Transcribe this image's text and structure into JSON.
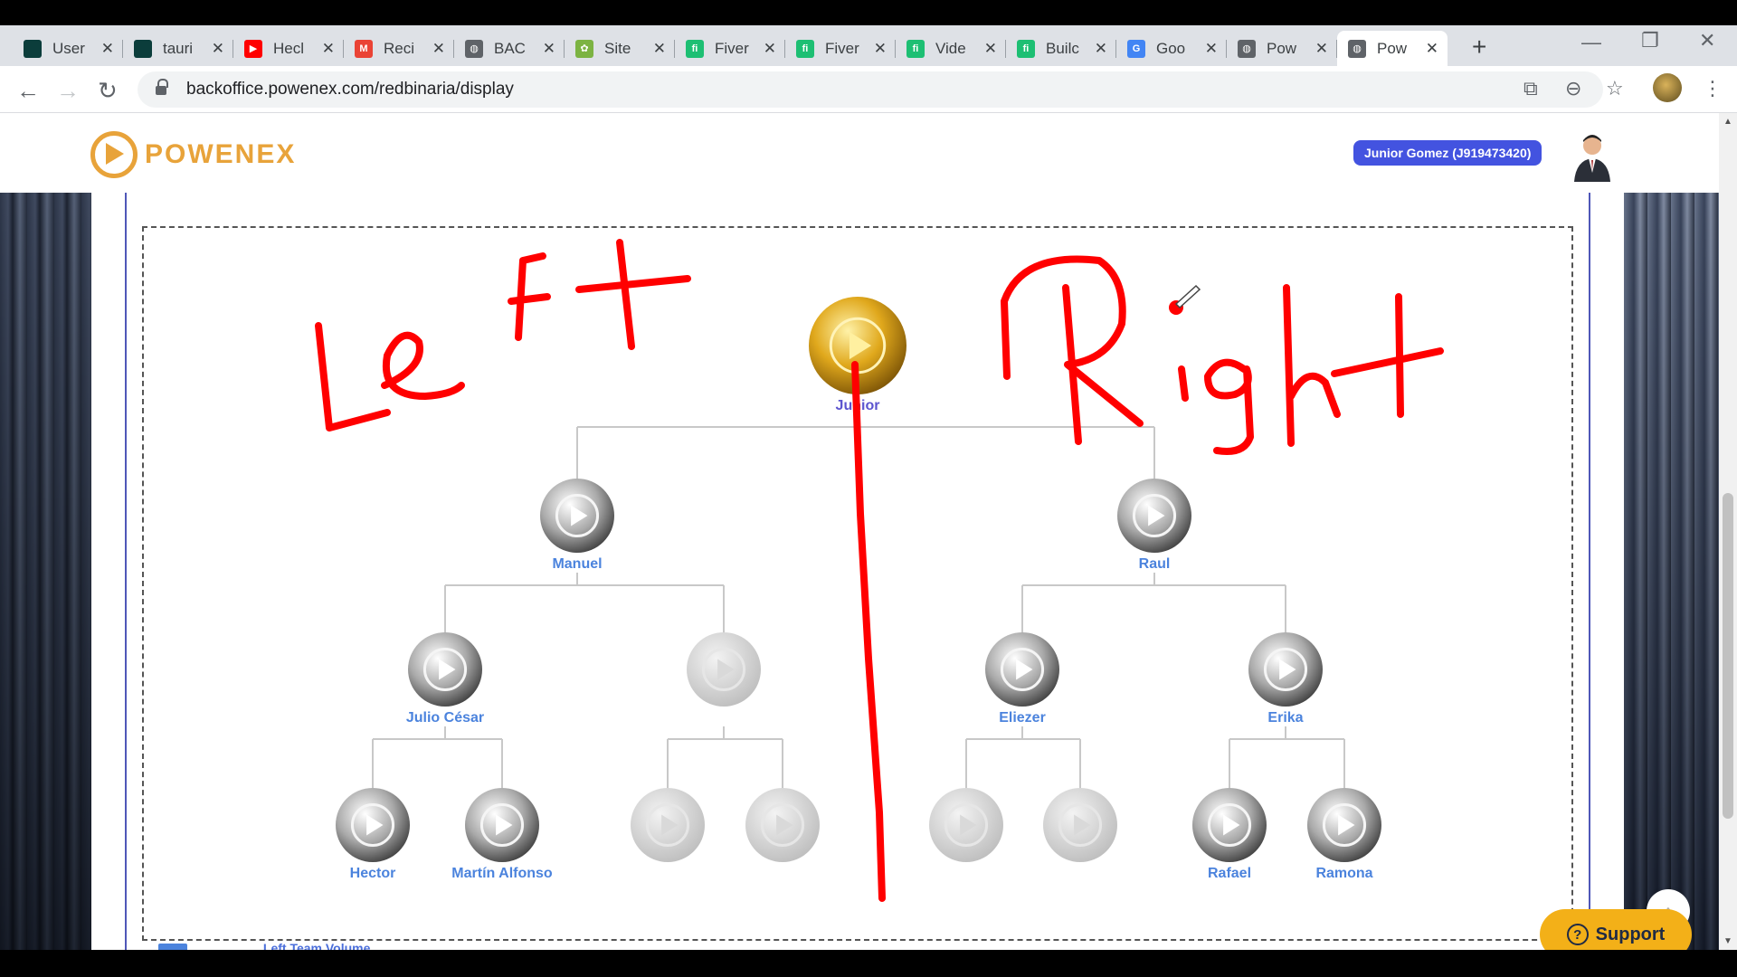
{
  "tabs": [
    {
      "title": "User",
      "favicon_color": "#0b3d3b",
      "favicon_glyph": ""
    },
    {
      "title": "tauri",
      "favicon_color": "#0b3d3b",
      "favicon_glyph": ""
    },
    {
      "title": "Hecl",
      "favicon_color": "#ff0000",
      "favicon_glyph": "▶"
    },
    {
      "title": "Reci",
      "favicon_color": "#ea4335",
      "favicon_glyph": "M"
    },
    {
      "title": "BAC",
      "favicon_color": "#5f6368",
      "favicon_glyph": "◍"
    },
    {
      "title": "Site",
      "favicon_color": "#7cb342",
      "favicon_glyph": "✿"
    },
    {
      "title": "Fiver",
      "favicon_color": "#1dbf73",
      "favicon_glyph": "fi"
    },
    {
      "title": "Fiver",
      "favicon_color": "#1dbf73",
      "favicon_glyph": "fi"
    },
    {
      "title": "Vide",
      "favicon_color": "#1dbf73",
      "favicon_glyph": "fi"
    },
    {
      "title": "Builc",
      "favicon_color": "#1dbf73",
      "favicon_glyph": "fi"
    },
    {
      "title": "Goo",
      "favicon_color": "#4285f4",
      "favicon_glyph": "G"
    },
    {
      "title": "Pow",
      "favicon_color": "#5f6368",
      "favicon_glyph": "◍"
    },
    {
      "title": "Pow",
      "favicon_color": "#5f6368",
      "favicon_glyph": "◍"
    }
  ],
  "toolbar": {
    "back_icon": "←",
    "forward_icon": "→",
    "reload_icon": "↻",
    "url": "backoffice.powenex.com/redbinaria/display",
    "translate_icon": "⧉",
    "zoom_icon": "⊖",
    "star_icon": "☆",
    "menu_icon": "⋮"
  },
  "window": {
    "minimize": "—",
    "restore": "❐",
    "close": "✕",
    "newtab": "+"
  },
  "site": {
    "logo_text": "POWENEX",
    "user_badge": "Junior Gomez (J919473420)",
    "accent": "#4353e0",
    "brand": "#e8a33a"
  },
  "tree": {
    "root": "Junior",
    "level1": [
      "Manuel",
      "Raul"
    ],
    "level2": [
      "Julio César",
      "",
      "Eliezer",
      "Erika"
    ],
    "level3": [
      "Hector",
      "Martín Alfonso",
      "",
      "",
      "",
      "",
      "Rafael",
      "Ramona"
    ]
  },
  "annotations": {
    "left": "LeFt",
    "right": "Right",
    "color": "#ff0000"
  },
  "bottom": {
    "label": "Left Team Volume"
  },
  "support": {
    "label": "Support",
    "icon": "?"
  }
}
